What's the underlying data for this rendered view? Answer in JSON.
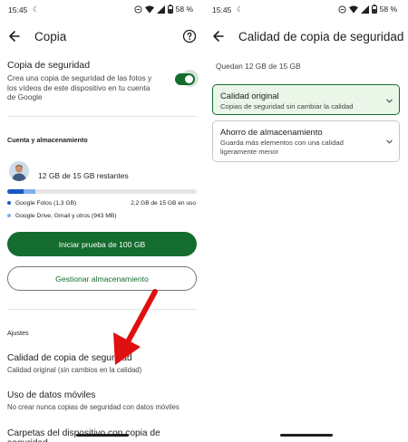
{
  "status": {
    "left_time": "15:45",
    "left_battery": "58 %",
    "right_time": "15:45",
    "right_battery": "58 %"
  },
  "left": {
    "title": "Copia",
    "backup": {
      "title": "Copia de seguridad",
      "description": "Crea una copia de seguridad de las fotos y los vídeos de este dispositivo en tu cuenta de Google",
      "enabled": true
    },
    "storage": {
      "section_label": "Cuenta y almacenamiento",
      "remaining": "12 GB de 15 GB restantes",
      "usage": "2,2 GB de 15 GB en uso",
      "segments": [
        {
          "label": "Google Fotos (1,3 GB)",
          "color": "#1a56c4",
          "fraction": 0.087
        },
        {
          "label": "Google Drive, Gmail y otros (943 MB)",
          "color": "#7fb0ec",
          "fraction": 0.063
        }
      ]
    },
    "primary_button": "Iniciar prueba de 100 GB",
    "secondary_button": "Gestionar almacenamiento",
    "settings_label": "Ajustes",
    "settings": [
      {
        "title": "Calidad de copia de seguridad",
        "subtitle": "Calidad original (sin cambios en la calidad)"
      },
      {
        "title": "Uso de datos móviles",
        "subtitle": "No crear nunca copias de seguridad con datos móviles"
      },
      {
        "title": "Carpetas del dispositivo con copia de seguridad",
        "subtitle": ""
      }
    ]
  },
  "right": {
    "title": "Calidad de copia de seguridad",
    "quota": "Quedan 12 GB de 15 GB",
    "options": [
      {
        "title": "Calidad original",
        "description": "Copias de seguridad sin cambiar la calidad",
        "selected": true
      },
      {
        "title": "Ahorro de almacenamiento",
        "description": "Guarda más elementos con una calidad ligeramente menor",
        "selected": false
      }
    ]
  },
  "colors": {
    "accent": "#146c2e",
    "selected_bg": "#eaf6e7",
    "annotation_arrow": "#e01010"
  },
  "icons": [
    "back-arrow-icon",
    "help-icon",
    "chevron-down-icon",
    "wifi-icon",
    "signal-icon",
    "battery-icon",
    "dnd-icon"
  ]
}
